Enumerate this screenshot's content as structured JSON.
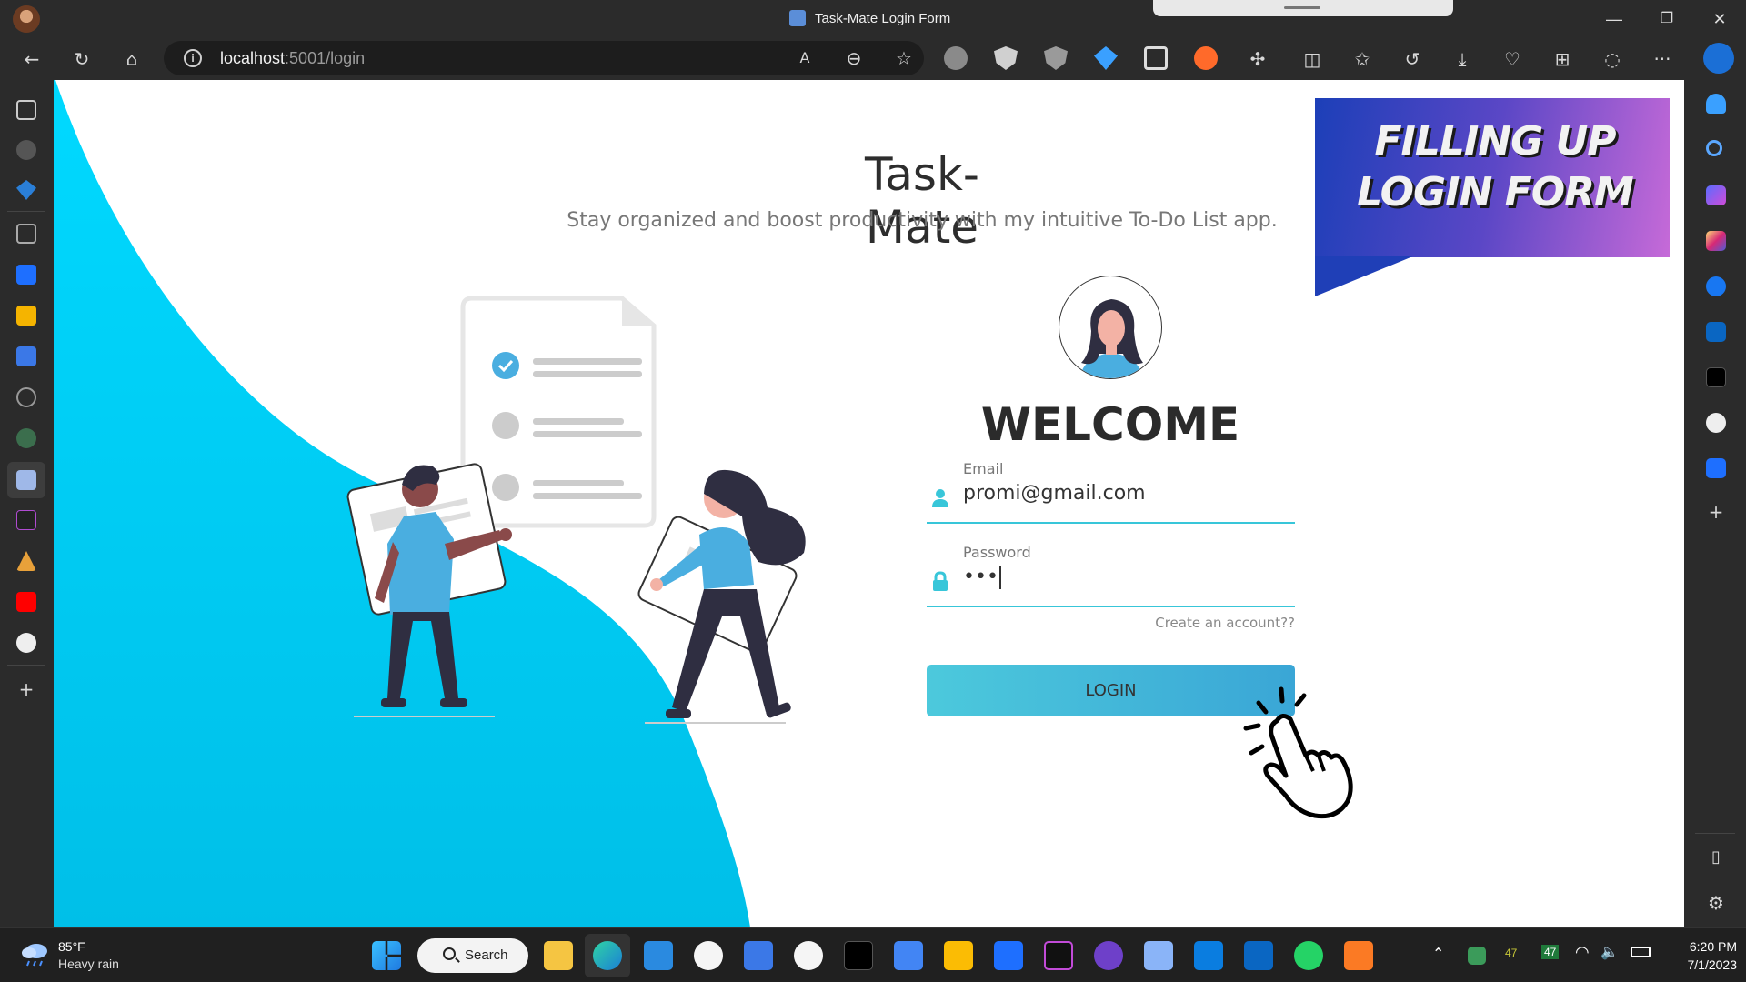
{
  "window": {
    "tab_title": "Task-Mate Login Form",
    "minimize": "—",
    "maximize": "❐",
    "close": "✕"
  },
  "toolbar": {
    "url_host": "localhost",
    "url_rest": ":5001/login",
    "more": "···"
  },
  "page": {
    "title": "Task-Mate",
    "subtitle": "Stay organized and boost productivity with my intuitive To-Do List app.",
    "welcome": "WELCOME",
    "email_label": "Email",
    "email_value": "promi@gmail.com",
    "password_label": "Password",
    "password_value": "•••",
    "create_account": "Create an account??",
    "login_button": "LOGIN",
    "accent_color": "#00d4ff",
    "button_color": "#45bfdb"
  },
  "promo": {
    "line1": "FILLING UP",
    "line2": "LOGIN FORM"
  },
  "taskbar": {
    "temperature": "85°F",
    "weather": "Heavy rain",
    "search": "Search",
    "badge1": "47",
    "badge2": "47",
    "time": "6:20 PM",
    "date": "7/1/2023"
  }
}
